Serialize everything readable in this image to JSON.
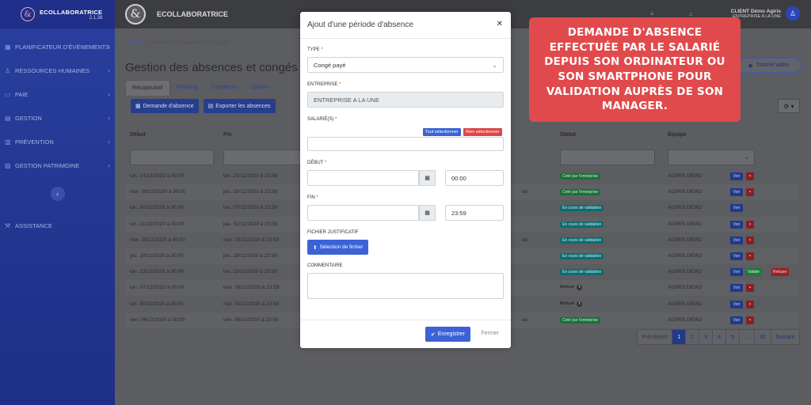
{
  "app": {
    "logo": "&",
    "name": "ECOLLABORATRICE",
    "version": "2.1.38"
  },
  "sidebar": {
    "items": [
      {
        "label": "PLANIFICATEUR D'ÉVÉNEMENTS",
        "icon": "grid-icon"
      },
      {
        "label": "RESSOURCES HUMAINES",
        "icon": "user-icon"
      },
      {
        "label": "PAIE",
        "icon": "money-icon"
      },
      {
        "label": "GESTION",
        "icon": "folder-icon"
      },
      {
        "label": "PRÉVENTION",
        "icon": "shield-icon"
      },
      {
        "label": "GESTION PATRIMOINE",
        "icon": "building-icon"
      }
    ],
    "assistance": "ASSISTANCE"
  },
  "topbar": {
    "title": "ECOLLABORATRICE",
    "user_name": "CLIENT Démo Agiris",
    "user_company": "ENTREPRISE A LA UNE"
  },
  "breadcrumb": {
    "home": "Paie",
    "separator": "/",
    "current": "Gestion des absences et congés"
  },
  "page": {
    "title": "Gestion des absences et congés",
    "tutorial": "Tutoriel vidéo"
  },
  "tabs": [
    "Récapitulatif",
    "Planning",
    "Compteurs",
    "Options"
  ],
  "actions": {
    "request": "Demande d'absence",
    "export": "Exporter les absences"
  },
  "table": {
    "headers": {
      "start": "Début",
      "end": "Fin",
      "status": "Statut",
      "team": "Équipe"
    },
    "rows": [
      {
        "start": "lun. 14/12/2020 à 00:00",
        "end": "lun. 21/12/2020 à 23:59",
        "extra": "",
        "status": "Créé par l'entreprise",
        "status_type": "green",
        "team": "AGIRIS DEMO",
        "trash": true,
        "validate": false
      },
      {
        "start": "mer. 09/12/2020 à 00:00",
        "end": "jeu. 10/12/2020 à 23:59",
        "extra": "ée",
        "status": "Créé par l'entreprise",
        "status_type": "green",
        "team": "AGIRIS DEMO",
        "trash": true,
        "validate": false
      },
      {
        "start": "lun. 30/11/2020 à 00:00",
        "end": "lun. 07/12/2020 à 23:59",
        "extra": "",
        "status": "En cours de validation",
        "status_type": "teal",
        "team": "AGIRIS DEMO",
        "trash": false,
        "validate": false
      },
      {
        "start": "lun. 21/12/2020 à 00:00",
        "end": "jeu. 31/12/2020 à 23:59",
        "extra": "",
        "status": "En cours de validation",
        "status_type": "teal",
        "team": "AGIRIS DEMO",
        "trash": true,
        "validate": false
      },
      {
        "start": "mer. 25/11/2020 à 00:00",
        "end": "mer. 25/11/2020 à 23:59",
        "extra": "ée",
        "status": "En cours de validation",
        "status_type": "teal",
        "team": "AGIRIS DEMO",
        "trash": true,
        "validate": false
      },
      {
        "start": "jeu. 19/11/2020 à 00:00",
        "end": "jeu. 19/11/2020 à 23:59",
        "extra": "",
        "status": "En cours de validation",
        "status_type": "teal",
        "team": "AGIRIS DEMO",
        "trash": true,
        "validate": false
      },
      {
        "start": "lun. 23/11/2020 à 00:00",
        "end": "lun. 23/11/2020 à 23:59",
        "extra": "",
        "status": "En cours de validation",
        "status_type": "teal",
        "team": "AGIRIS DEMO",
        "trash": false,
        "validate": true
      },
      {
        "start": "lun. 07/12/2020 à 00:00",
        "end": "mar. 08/12/2020 à 23:59",
        "extra": "",
        "status": "Refusé",
        "status_type": "refused",
        "team": "AGIRIS DEMO",
        "trash": true,
        "validate": false
      },
      {
        "start": "lun. 30/11/2020 à 00:00",
        "end": "mar. 01/12/2020 à 23:59",
        "extra": "",
        "status": "Refusé",
        "status_type": "refused",
        "team": "AGIRIS DEMO",
        "trash": true,
        "validate": false
      },
      {
        "start": "ven. 06/11/2020 à 00:00",
        "end": "ven. 06/11/2020 à 23:59",
        "extra": "ée",
        "status": "Créé par l'entreprise",
        "status_type": "green",
        "team": "AGIRIS DEMO",
        "trash": true,
        "validate": false
      }
    ],
    "view": "Voir",
    "validate": "Valider",
    "refuse": "Refuser"
  },
  "pagination": {
    "prev": "Précédent",
    "pages": [
      "1",
      "2",
      "3",
      "4",
      "5",
      "...",
      "10"
    ],
    "next": "Suivant",
    "active": "1"
  },
  "modal": {
    "title": "Ajout d'une période d'absence",
    "type_label": "TYPE",
    "type_value": "Congé payé",
    "company_label": "ENTREPRISE",
    "company_value": "ENTREPRISE A LA UNE",
    "employees_label": "SALARIÉ(S)",
    "select_all": "Tout sélectionner",
    "select_none": "Rien sélectionner",
    "start_label": "DÉBUT",
    "start_time": "00:00",
    "end_label": "FIN",
    "end_time": "23:59",
    "file_label": "FICHIER JUSTIFICATIF",
    "file_button": "Sélection de fichier",
    "comment_label": "COMMENTAIRE",
    "save": "Enregistrer",
    "close": "Fermer",
    "required": "*"
  },
  "callout": "Demande d'absence effectuée par le salarié depuis son ordinateur ou son smartphone pour validation auprès de son manager."
}
